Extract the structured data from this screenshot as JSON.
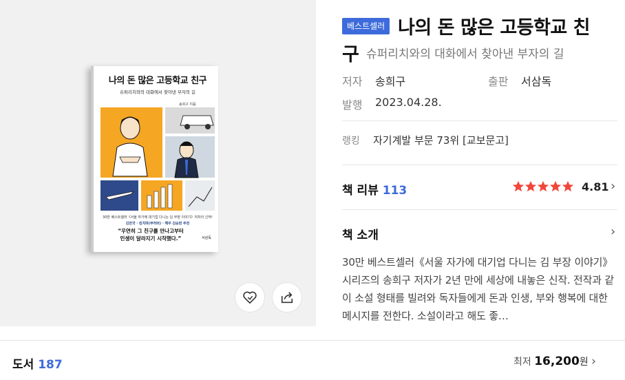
{
  "badge": "베스트셀러",
  "title": {
    "line1": "나의 돈 많은 고등학교 친",
    "line2": "구"
  },
  "subtitle": "슈퍼리치와의 대화에서 찾아낸 부자의 길",
  "meta": {
    "author_label": "저자",
    "author": "송희구",
    "publisher_label": "출판",
    "publisher": "서삼독",
    "date_label": "발행",
    "date": "2023.04.28."
  },
  "ranking": {
    "label": "랭킹",
    "value": "자기계발 부문 73위 [교보문고]"
  },
  "review": {
    "label": "책 리뷰",
    "count": "113",
    "rating": "4.81",
    "stars": 5,
    "star_color": "#f0473a"
  },
  "intro": {
    "label": "책 소개",
    "text": "30만 베스트셀러《서울 자가에 대기업 다니는 김 부장 이야기》시리즈의 송희구 저자가 2년 만에 세상에 내놓은 신작. 전작과 같이 소설 형태를 빌려와 독자들에게 돈과 인생, 부와 행복에 대한 메시지를 전한다. 소설이라고 해도 좋…"
  },
  "bottom": {
    "label": "도서",
    "count": "187",
    "min_label": "최저",
    "price": "16,200",
    "currency": "원"
  },
  "cover": {
    "title": "나의 돈 많은 고등학교 친구",
    "subtitle": "슈퍼리치와의 대화에서 찾아낸 부자의 길",
    "author": "송희구 지음",
    "note1": "30만 베스트셀러《서울 자가에 대기업 다니는 김 부장 이야기》저자의 신작!",
    "note2": "김한국 · 킹치며(부러버) · 해우 김승현 추천",
    "quote1": "“우연히 그 친구를 만나고부터",
    "quote2": "인생이 달라지기 시작했다.”",
    "publisher": "서삼독"
  },
  "icons": {
    "like": "heart-icon",
    "share": "share-icon"
  },
  "colors": {
    "accent": "#3d6bdb",
    "star": "#f0473a"
  }
}
